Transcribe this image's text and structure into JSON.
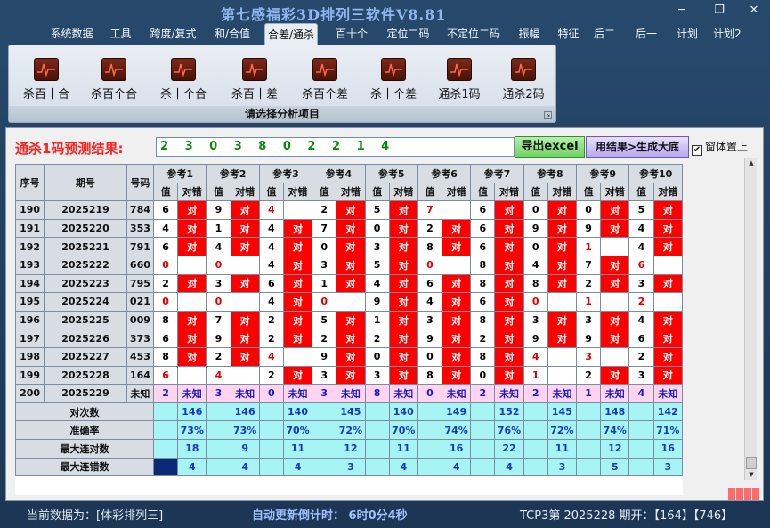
{
  "window": {
    "title": "第七感福彩3D排列三软件V8.81"
  },
  "menu": [
    "系统数据",
    "工具",
    "跨度/复式",
    "和/合值",
    "合差/通杀",
    "百十个",
    "定位二码",
    "不定位二码",
    "振幅",
    "特征",
    "后二",
    "后一",
    "计划",
    "计划2"
  ],
  "menu_active": 4,
  "ribbon": {
    "tools": [
      "杀百十合",
      "杀百个合",
      "杀十个合",
      "杀百十差",
      "杀百个差",
      "杀十个差",
      "通杀1码",
      "通杀2码"
    ],
    "footer": "请选择分析项目"
  },
  "prediction": {
    "label": "通杀1码预测结果:",
    "value": "2 3 0 3 8 0 2 2 1 4",
    "export_button": "导出excel",
    "generate_button": "用结果>生成大底",
    "topmost_checkbox": "窗体置上",
    "topmost_checked": true
  },
  "table": {
    "col_seq": "序号",
    "col_issue": "期号",
    "col_number": "号码",
    "refs": [
      "参考1",
      "参考2",
      "参考3",
      "参考4",
      "参考5",
      "参考6",
      "参考7",
      "参考8",
      "参考9",
      "参考10"
    ],
    "sub_val": "值",
    "sub_result": "对错",
    "correct_mark": "对",
    "rows": [
      {
        "seq": "190",
        "issue": "2025219",
        "num": "784",
        "vals": [
          "6",
          "9",
          "4",
          "2",
          "5",
          "7",
          "6",
          "0",
          "0",
          "5"
        ],
        "hits": [
          1,
          1,
          0,
          1,
          1,
          0,
          1,
          1,
          1,
          1
        ]
      },
      {
        "seq": "191",
        "issue": "2025220",
        "num": "353",
        "vals": [
          "4",
          "1",
          "4",
          "7",
          "0",
          "2",
          "6",
          "9",
          "9",
          "4"
        ],
        "hits": [
          1,
          1,
          1,
          1,
          1,
          1,
          1,
          1,
          1,
          1
        ]
      },
      {
        "seq": "192",
        "issue": "2025221",
        "num": "791",
        "vals": [
          "6",
          "4",
          "4",
          "0",
          "3",
          "8",
          "6",
          "0",
          "1",
          "4"
        ],
        "hits": [
          1,
          1,
          1,
          1,
          1,
          1,
          1,
          1,
          0,
          1
        ]
      },
      {
        "seq": "193",
        "issue": "2025222",
        "num": "660",
        "vals": [
          "0",
          "0",
          "4",
          "3",
          "5",
          "0",
          "8",
          "4",
          "7",
          "6"
        ],
        "hits": [
          0,
          0,
          1,
          1,
          1,
          0,
          1,
          1,
          1,
          0
        ]
      },
      {
        "seq": "194",
        "issue": "2025223",
        "num": "795",
        "vals": [
          "2",
          "3",
          "6",
          "1",
          "4",
          "6",
          "8",
          "8",
          "2",
          "3"
        ],
        "hits": [
          1,
          1,
          1,
          1,
          1,
          1,
          1,
          1,
          1,
          1
        ]
      },
      {
        "seq": "195",
        "issue": "2025224",
        "num": "021",
        "vals": [
          "0",
          "0",
          "4",
          "0",
          "9",
          "4",
          "6",
          "0",
          "1",
          "2"
        ],
        "hits": [
          0,
          0,
          1,
          0,
          1,
          1,
          1,
          0,
          0,
          0
        ]
      },
      {
        "seq": "196",
        "issue": "2025225",
        "num": "009",
        "vals": [
          "8",
          "7",
          "2",
          "5",
          "1",
          "3",
          "8",
          "3",
          "3",
          "4"
        ],
        "hits": [
          1,
          1,
          1,
          1,
          1,
          1,
          1,
          1,
          1,
          1
        ]
      },
      {
        "seq": "197",
        "issue": "2025226",
        "num": "373",
        "vals": [
          "6",
          "9",
          "2",
          "2",
          "2",
          "9",
          "2",
          "9",
          "9",
          "6"
        ],
        "hits": [
          1,
          1,
          1,
          1,
          1,
          1,
          1,
          1,
          1,
          1
        ]
      },
      {
        "seq": "198",
        "issue": "2025227",
        "num": "453",
        "vals": [
          "8",
          "2",
          "4",
          "9",
          "0",
          "0",
          "8",
          "4",
          "3",
          "2"
        ],
        "hits": [
          1,
          1,
          0,
          1,
          1,
          1,
          1,
          0,
          0,
          1
        ]
      },
      {
        "seq": "199",
        "issue": "2025228",
        "num": "164",
        "vals": [
          "6",
          "4",
          "2",
          "3",
          "3",
          "8",
          "0",
          "1",
          "2",
          "3"
        ],
        "hits": [
          0,
          0,
          1,
          1,
          1,
          1,
          1,
          0,
          1,
          1
        ]
      }
    ],
    "current": {
      "seq": "200",
      "issue": "2025229",
      "num": "未知",
      "vals": [
        "2",
        "3",
        "0",
        "3",
        "8",
        "0",
        "2",
        "2",
        "1",
        "4"
      ],
      "result": "未知"
    },
    "stats": [
      {
        "label": "对次数",
        "values": [
          "146",
          "146",
          "140",
          "145",
          "140",
          "149",
          "152",
          "145",
          "148",
          "142"
        ]
      },
      {
        "label": "准确率",
        "values": [
          "73%",
          "73%",
          "70%",
          "72%",
          "70%",
          "74%",
          "76%",
          "72%",
          "74%",
          "71%"
        ]
      },
      {
        "label": "最大连对数",
        "values": [
          "18",
          "9",
          "11",
          "12",
          "11",
          "16",
          "22",
          "11",
          "12",
          "16"
        ]
      },
      {
        "label": "最大连错数",
        "values": [
          "4",
          "4",
          "4",
          "3",
          "4",
          "4",
          "4",
          "3",
          "5",
          "3"
        ]
      }
    ]
  },
  "status": {
    "current_data": "当前数据为：[体彩排列三]",
    "countdown": "自动更新倒计时：  6时0分4秒",
    "draw_info": "TCP3第  2025228  期开：【164】【746】"
  },
  "colors": {
    "correct_bg": "#ff0000",
    "current_row_bg": "#ffd4f0",
    "stats_bg": "#a6f4f4",
    "accent_red": "#ff2020",
    "value_green": "#0a8a0a"
  }
}
